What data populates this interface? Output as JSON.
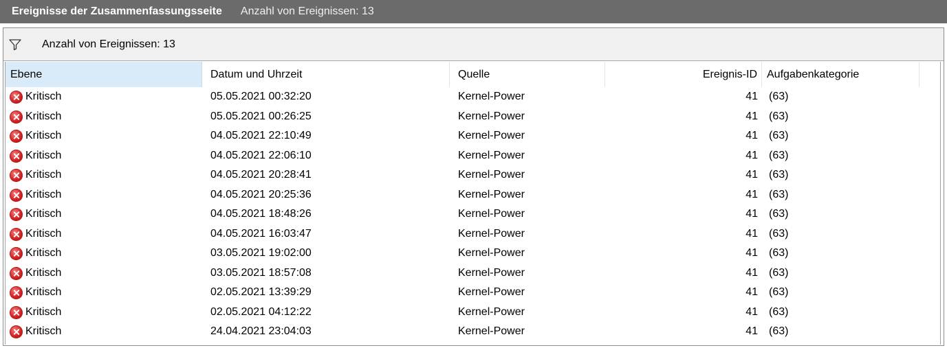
{
  "window": {
    "title": "Ereignisse der Zusammenfassungsseite",
    "subtitle": "Anzahl von Ereignissen: 13"
  },
  "filter": {
    "icon": "funnel-icon",
    "text": "Anzahl von Ereignissen: 13"
  },
  "table": {
    "columns": [
      "Ebene",
      "Datum und Uhrzeit",
      "Quelle",
      "Ereignis-ID",
      "Aufgabenkategorie"
    ],
    "rows": [
      {
        "level": "Kritisch",
        "datetime": "05.05.2021 00:32:20",
        "source": "Kernel-Power",
        "id": "41",
        "category": "(63)"
      },
      {
        "level": "Kritisch",
        "datetime": "05.05.2021 00:26:25",
        "source": "Kernel-Power",
        "id": "41",
        "category": "(63)"
      },
      {
        "level": "Kritisch",
        "datetime": "04.05.2021 22:10:49",
        "source": "Kernel-Power",
        "id": "41",
        "category": "(63)"
      },
      {
        "level": "Kritisch",
        "datetime": "04.05.2021 22:06:10",
        "source": "Kernel-Power",
        "id": "41",
        "category": "(63)"
      },
      {
        "level": "Kritisch",
        "datetime": "04.05.2021 20:28:41",
        "source": "Kernel-Power",
        "id": "41",
        "category": "(63)"
      },
      {
        "level": "Kritisch",
        "datetime": "04.05.2021 20:25:36",
        "source": "Kernel-Power",
        "id": "41",
        "category": "(63)"
      },
      {
        "level": "Kritisch",
        "datetime": "04.05.2021 18:48:26",
        "source": "Kernel-Power",
        "id": "41",
        "category": "(63)"
      },
      {
        "level": "Kritisch",
        "datetime": "04.05.2021 16:03:47",
        "source": "Kernel-Power",
        "id": "41",
        "category": "(63)"
      },
      {
        "level": "Kritisch",
        "datetime": "03.05.2021 19:02:00",
        "source": "Kernel-Power",
        "id": "41",
        "category": "(63)"
      },
      {
        "level": "Kritisch",
        "datetime": "03.05.2021 18:57:08",
        "source": "Kernel-Power",
        "id": "41",
        "category": "(63)"
      },
      {
        "level": "Kritisch",
        "datetime": "02.05.2021 13:39:29",
        "source": "Kernel-Power",
        "id": "41",
        "category": "(63)"
      },
      {
        "level": "Kritisch",
        "datetime": "02.05.2021 04:12:22",
        "source": "Kernel-Power",
        "id": "41",
        "category": "(63)"
      },
      {
        "level": "Kritisch",
        "datetime": "24.04.2021 23:04:03",
        "source": "Kernel-Power",
        "id": "41",
        "category": "(63)"
      }
    ]
  },
  "icons": {
    "level_icon": "critical-error-icon"
  },
  "colors": {
    "titlebar": "#6b6b6b",
    "selected_header": "#d9ebf9",
    "critical": "#d32020"
  }
}
